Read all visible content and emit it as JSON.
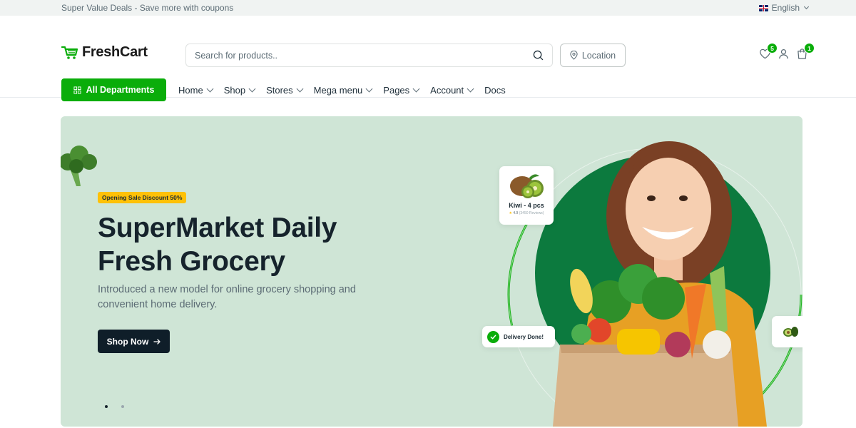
{
  "topbar": {
    "promo": "Super Value Deals - Save more with coupons",
    "language": "English"
  },
  "header": {
    "logo": "FreshCart",
    "search_placeholder": "Search for products..",
    "location_label": "Location",
    "wishlist_count": "5",
    "cart_count": "1"
  },
  "nav": {
    "departments_label": "All Departments",
    "items": [
      {
        "label": "Home",
        "dropdown": true
      },
      {
        "label": "Shop",
        "dropdown": true
      },
      {
        "label": "Stores",
        "dropdown": true
      },
      {
        "label": "Mega menu",
        "dropdown": true
      },
      {
        "label": "Pages",
        "dropdown": true
      },
      {
        "label": "Account",
        "dropdown": true
      },
      {
        "label": "Docs",
        "dropdown": false
      }
    ]
  },
  "hero": {
    "badge": "Opening Sale Discount 50%",
    "title": "SuperMarket Daily Fresh Grocery",
    "subtitle": "Introduced a new model for online grocery shopping and convenient home delivery.",
    "cta": "Shop Now",
    "slides": 2,
    "active_slide": 1,
    "kiwi_card": {
      "name": "Kiwi - 4 pcs",
      "rating": "4.9",
      "reviews": "(3450 Reviews)"
    },
    "delivery_label": "Delivery Done!"
  },
  "colors": {
    "brand": "#0aad0a",
    "hero_bg": "#cfe5d6",
    "dark": "#0f1e29",
    "badge": "#ffc107"
  }
}
